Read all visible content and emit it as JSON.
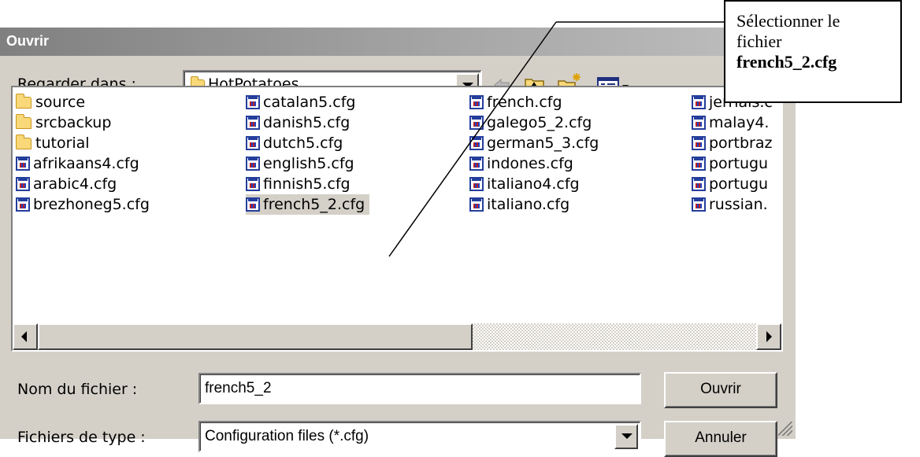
{
  "window": {
    "title": "Ouvrir"
  },
  "toolbar": {
    "look_in_label": "Regarder dans :",
    "look_in_value": "HotPotatoes",
    "back_icon": "back-arrow-icon",
    "up_icon": "up-folder-icon",
    "new_folder_icon": "new-folder-icon",
    "view_menu_icon": "view-menu-icon"
  },
  "files": {
    "col1": [
      {
        "name": "source",
        "type": "folder"
      },
      {
        "name": "srcbackup",
        "type": "folder"
      },
      {
        "name": "tutorial",
        "type": "folder"
      },
      {
        "name": "afrikaans4.cfg",
        "type": "cfg"
      },
      {
        "name": "arabic4.cfg",
        "type": "cfg"
      },
      {
        "name": "brezhoneg5.cfg",
        "type": "cfg"
      }
    ],
    "col2": [
      {
        "name": "catalan5.cfg",
        "type": "cfg"
      },
      {
        "name": "danish5.cfg",
        "type": "cfg"
      },
      {
        "name": "dutch5.cfg",
        "type": "cfg"
      },
      {
        "name": "english5.cfg",
        "type": "cfg"
      },
      {
        "name": "finnish5.cfg",
        "type": "cfg"
      },
      {
        "name": "french5_2.cfg",
        "type": "cfg",
        "selected": true
      }
    ],
    "col3": [
      {
        "name": "french.cfg",
        "type": "cfg"
      },
      {
        "name": "galego5_2.cfg",
        "type": "cfg"
      },
      {
        "name": "german5_3.cfg",
        "type": "cfg"
      },
      {
        "name": "indones.cfg",
        "type": "cfg"
      },
      {
        "name": "italiano4.cfg",
        "type": "cfg"
      },
      {
        "name": "italiano.cfg",
        "type": "cfg"
      }
    ],
    "col4": [
      {
        "name": "jerriais.c",
        "type": "cfg"
      },
      {
        "name": "malay4.",
        "type": "cfg"
      },
      {
        "name": "portbraz",
        "type": "cfg"
      },
      {
        "name": "portugu",
        "type": "cfg"
      },
      {
        "name": "portugu",
        "type": "cfg"
      },
      {
        "name": "russian.",
        "type": "cfg"
      }
    ]
  },
  "scroll": {
    "position": 0.0
  },
  "filename": {
    "label": "Nom du fichier :",
    "value": "french5_2"
  },
  "filetype": {
    "label": "Fichiers de type :",
    "value": "Configuration files (*.cfg)"
  },
  "buttons": {
    "open": "Ouvrir",
    "cancel": "Annuler"
  },
  "callout": {
    "line1": "Sélectionner le",
    "line2": "fichier",
    "line3": "french5_2.cfg"
  }
}
